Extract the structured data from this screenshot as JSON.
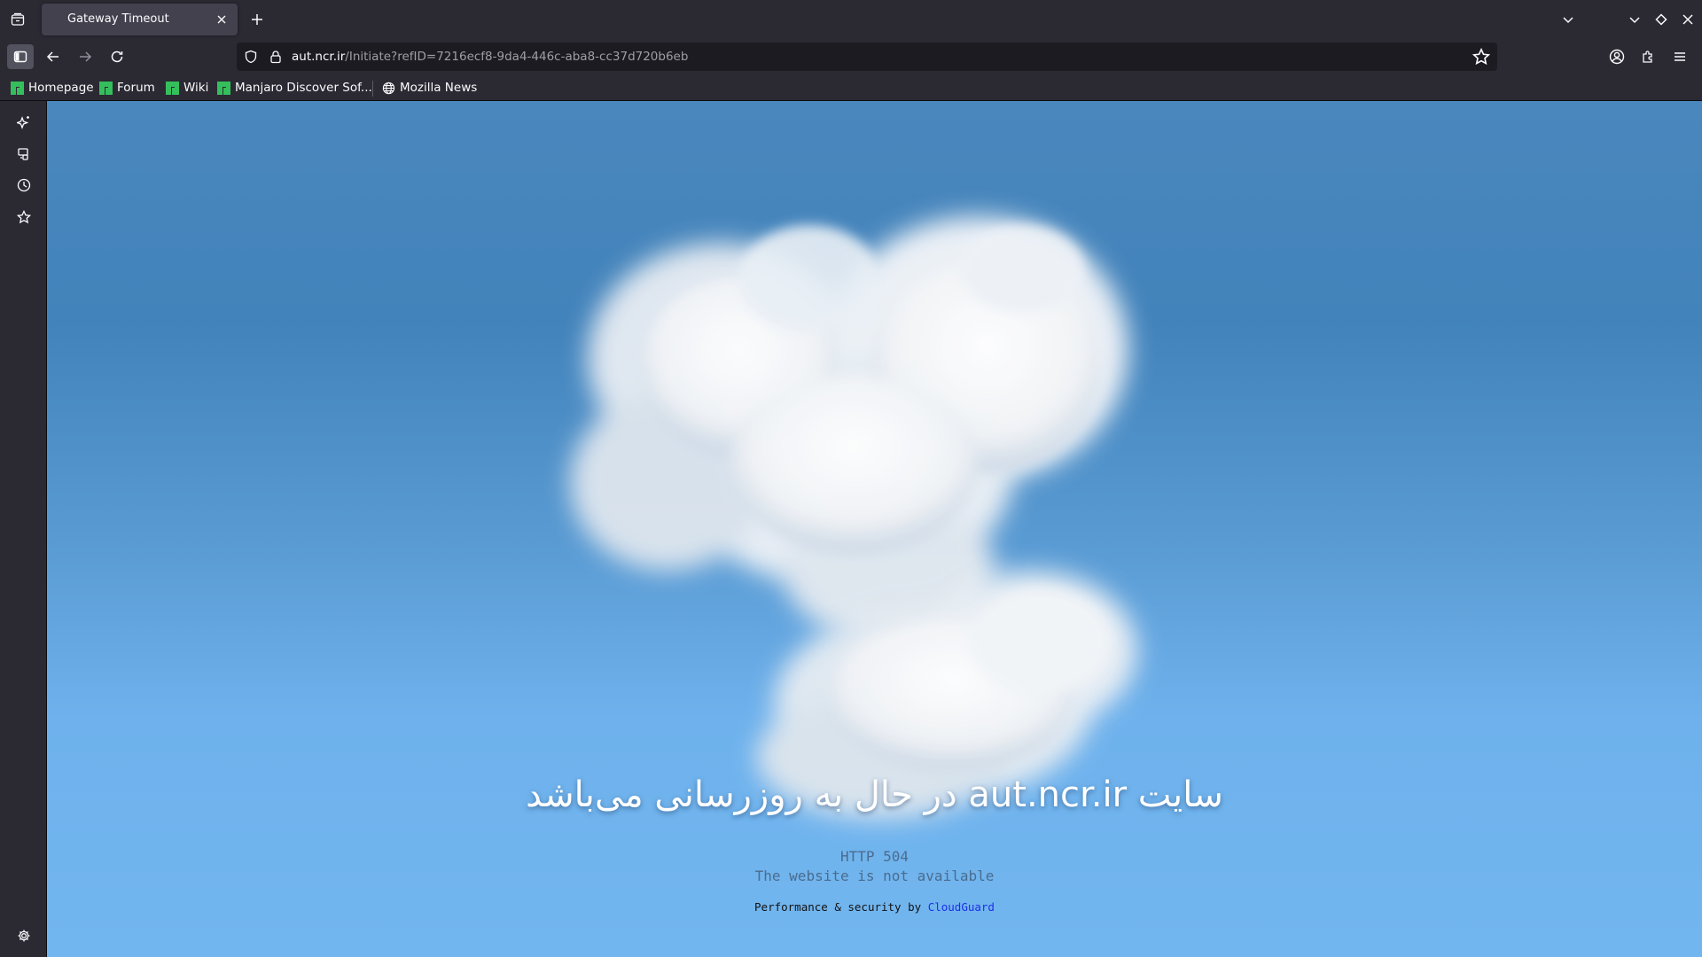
{
  "tabbar": {
    "active_tab_title": "Gateway Timeout"
  },
  "navbar": {
    "url_domain": "aut.ncr.ir",
    "url_path": "/Initiate?refID=7216ecf8-9da4-446c-aba8-cc37d720b6eb"
  },
  "bookmarks": [
    {
      "label": "Homepage",
      "icon": "manjaro-icon"
    },
    {
      "label": "Forum",
      "icon": "manjaro-icon"
    },
    {
      "label": "Wiki",
      "icon": "manjaro-icon"
    },
    {
      "label": "Manjaro Discover Sof...",
      "icon": "manjaro-icon"
    },
    {
      "label": "Mozilla News",
      "icon": "globe-icon"
    }
  ],
  "page": {
    "title_fa": "سایت aut.ncr.ir در حال به روزرسانی می‌باشد",
    "http_code": "HTTP 504",
    "http_message": "The website is not available",
    "powered_prefix": "Performance & security by",
    "powered_link": "CloudGuard"
  },
  "colors": {
    "chrome_bg": "#2b2a33",
    "urlbar_bg": "#1c1b22",
    "sky_top": "#4a87bd",
    "sky_bottom": "#72b6ef",
    "link": "#1c2ee8",
    "manjaro_green": "#35bf5c"
  }
}
